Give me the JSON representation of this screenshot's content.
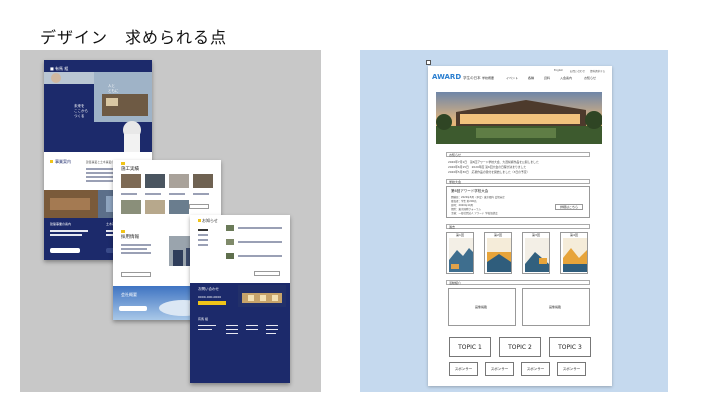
{
  "slide": {
    "title": "デザイン　求められる点"
  },
  "left_mockups": {
    "card1": {
      "logo": "■ 有馬 組",
      "hero_lines": [
        "未来を",
        "ここから",
        "つくる",
        "人と",
        "ともに"
      ],
      "section_heading": "事業案内",
      "section_sub": "建築事業と土木事業の取り組み",
      "buttons": [
        "建築事業の案内",
        "土木事業"
      ]
    },
    "card2": {
      "heading_works": "施工実績",
      "heading_recruit": "採用情報",
      "heading_company": "会社概要"
    },
    "card3": {
      "heading_news": "お知らせ",
      "heading_contact": "お問い合わせ",
      "phone": "0000-000-0000",
      "footer_company": "有馬 組"
    },
    "colors": {
      "navy": "#1c2a6b",
      "yellow": "#f0c419"
    }
  },
  "wireframe": {
    "logo": "AWARD",
    "logo_sub": "学生の日本",
    "top_links": [
      "English",
      "お問い合わせ",
      "資料請求する"
    ],
    "nav": [
      "学校概要",
      "イベント",
      "各種",
      "資料",
      "入会案内",
      "お知らせ"
    ],
    "sections": {
      "news": "お知らせ",
      "events": "学校大会",
      "past": "過去",
      "photos": "活動紹介"
    },
    "news_items": [
      "2020年7月1日　第6回アワード学校大会、大賞候補作品を公開しました",
      "2020年6月15日　2020年度 第6回大会の日程が決まりました",
      "2020年5月30日　応募作品の受付を開始しました（3日の予定）"
    ],
    "event": {
      "title": "第6回アワード学校大会",
      "lines": [
        "開催日：2020年8月（予定）東京都内 会場未定",
        "参加者：学生 約200名",
        "日時：2020年10月",
        "場所：東京国際フォーラム",
        "主催：一般社団法人 アワード 学校協議会"
      ],
      "button": "詳細はこちら"
    },
    "posters": [
      "第1回",
      "第2回",
      "第3回",
      "第4回"
    ],
    "photo_placeholders": [
      "画像掲載",
      "画像掲載"
    ],
    "topics": [
      "TOPIC 1",
      "TOPIC 2",
      "TOPIC 3"
    ],
    "sponsors": [
      "スポンサー",
      "スポンサー",
      "スポンサー",
      "スポンサー"
    ]
  }
}
